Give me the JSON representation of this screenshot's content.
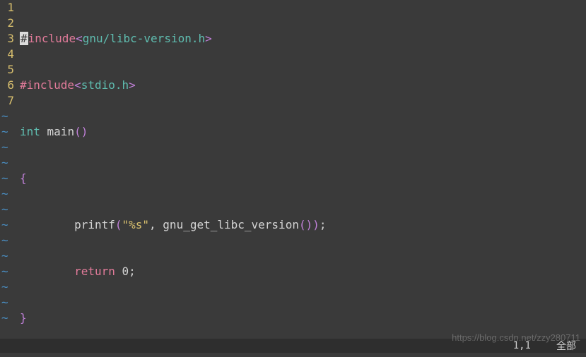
{
  "gutter": {
    "lines": [
      "1",
      "2",
      "3",
      "4",
      "5",
      "6",
      "7"
    ]
  },
  "code": {
    "l1": {
      "cursor": "#",
      "include": "include",
      "lt": "<",
      "header": "gnu/libc-version.h",
      "gt": ">"
    },
    "l2": {
      "hash": "#include",
      "lt": "<",
      "header": "stdio.h",
      "gt": ">"
    },
    "l3": {
      "type": "int",
      "name": " main",
      "paren": "()"
    },
    "l4": {
      "brace": "{"
    },
    "l5": {
      "indent": "        ",
      "fn": "printf",
      "lp": "(",
      "str": "\"%s\"",
      "comma": ", gnu_get_libc_version",
      "rp": "())",
      "semi": ";"
    },
    "l6": {
      "indent": "        ",
      "ret": "return",
      "val": " 0;"
    },
    "l7": {
      "brace": "}"
    }
  },
  "tildes": [
    "~",
    "~",
    "~",
    "~",
    "~",
    "~",
    "~",
    "~",
    "~",
    "~",
    "~",
    "~",
    "~",
    "~"
  ],
  "status": {
    "pos": "1,1",
    "scroll": "全部"
  },
  "watermark": "https://blog.csdn.net/zzy280711"
}
